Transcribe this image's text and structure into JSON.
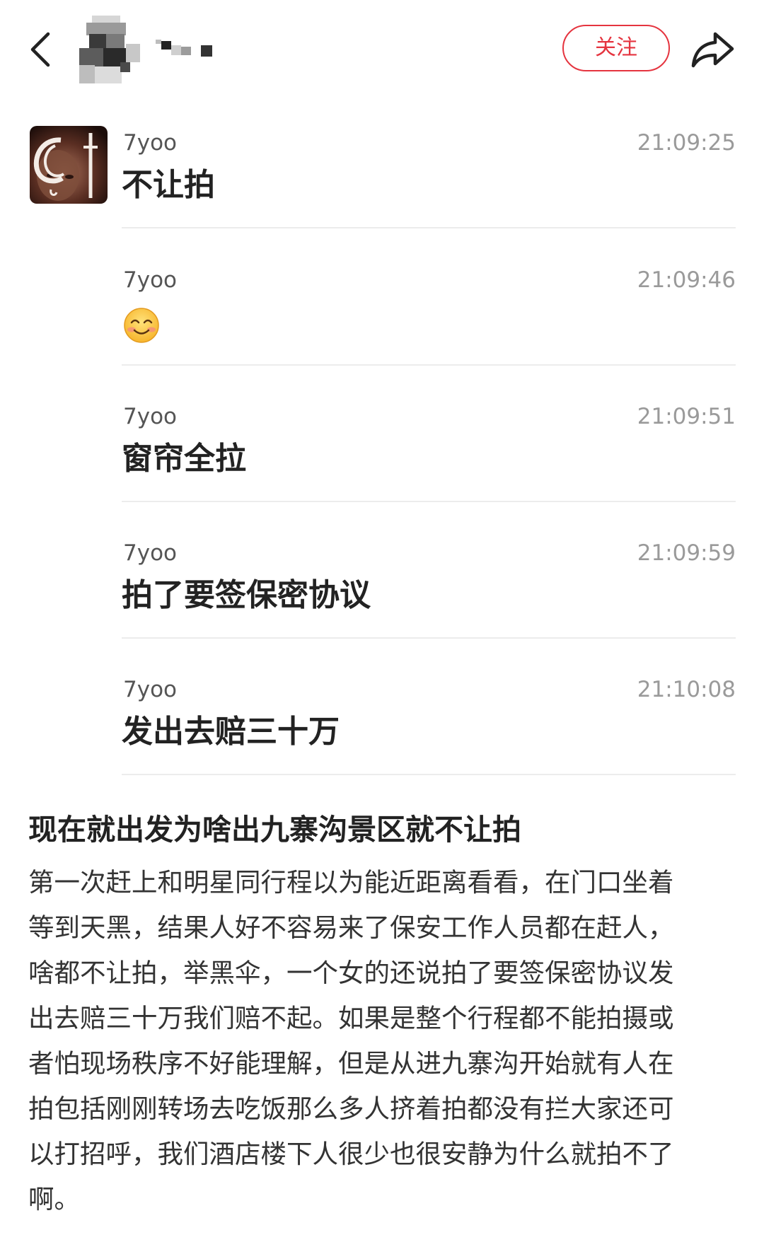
{
  "header": {
    "follow_label": "关注"
  },
  "messages": [
    {
      "author": "7yoo",
      "time": "21:09:25",
      "text": "不让拍"
    },
    {
      "author": "7yoo",
      "time": "21:09:46",
      "text": "",
      "emoji": "smiling-face-emoji"
    },
    {
      "author": "7yoo",
      "time": "21:09:51",
      "text": "窗帘全拉"
    },
    {
      "author": "7yoo",
      "time": "21:09:59",
      "text": "拍了要签保密协议"
    },
    {
      "author": "7yoo",
      "time": "21:10:08",
      "text": "发出去赔三十万"
    }
  ],
  "post": {
    "title": "现在就出发为啥出九寨沟景区就不让拍",
    "lines": [
      "第一次赶上和明星同行程以为能近距离看看，在门口坐着",
      "等到天黑，结果人好不容易来了保安工作人员都在赶人，",
      "啥都不让拍，举黑伞，一个女的还说拍了要签保密协议发",
      "出去赔三十万我们赔不起。如果是整个行程都不能拍摄或",
      "者怕现场秩序不好能理解，但是从进九寨沟开始就有人在",
      "拍包括刚刚转场去吃饭那么多人挤着拍都没有拦大家还可",
      "以打招呼，我们酒店楼下人很少也很安静为什么就拍不了",
      "啊。"
    ]
  },
  "colors": {
    "accent": "#e5343f",
    "divider": "#ececec",
    "meta_text": "#9a9a9a"
  },
  "icons": {
    "back": "chevron-left-icon",
    "share": "share-arrow-icon"
  }
}
